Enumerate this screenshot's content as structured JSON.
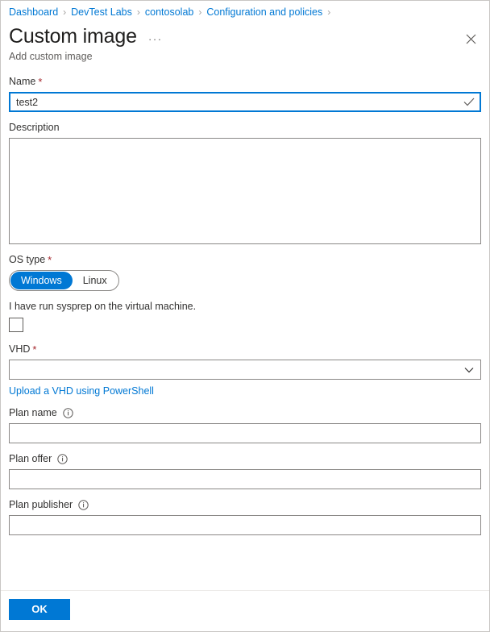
{
  "breadcrumb": {
    "separator": "›",
    "items": [
      {
        "label": "Dashboard"
      },
      {
        "label": "DevTest Labs"
      },
      {
        "label": "contosolab"
      },
      {
        "label": "Configuration and policies"
      }
    ]
  },
  "header": {
    "title": "Custom image",
    "subtitle": "Add custom image",
    "more_label": "···",
    "more_icon": "ellipsis-icon",
    "close_icon": "close-icon"
  },
  "form": {
    "name": {
      "label": "Name",
      "required_marker": "*",
      "value": "test2",
      "placeholder": "",
      "validation_icon": "checkmark-icon"
    },
    "description": {
      "label": "Description",
      "value": "",
      "placeholder": ""
    },
    "os_type": {
      "label": "OS type",
      "required_marker": "*",
      "selected": "Windows",
      "options": [
        {
          "label": "Windows",
          "selected": true
        },
        {
          "label": "Linux",
          "selected": false
        }
      ]
    },
    "sysprep": {
      "label": "I have run sysprep on the virtual machine.",
      "checked": false
    },
    "vhd": {
      "label": "VHD",
      "required_marker": "*",
      "value": "",
      "chevron_icon": "chevron-down-icon",
      "upload_link": "Upload a VHD using PowerShell"
    },
    "plan_name": {
      "label": "Plan name",
      "value": "",
      "placeholder": "",
      "info_icon": "info-icon"
    },
    "plan_offer": {
      "label": "Plan offer",
      "value": "",
      "placeholder": "",
      "info_icon": "info-icon"
    },
    "plan_publisher": {
      "label": "Plan publisher",
      "value": "",
      "placeholder": "",
      "info_icon": "info-icon"
    }
  },
  "footer": {
    "ok_label": "OK"
  },
  "colors": {
    "accent": "#0078d4",
    "required": "#a4262c",
    "border": "#8a8886",
    "link": "#0078d4",
    "text": "#323130",
    "subtle_text": "#605e5c"
  }
}
